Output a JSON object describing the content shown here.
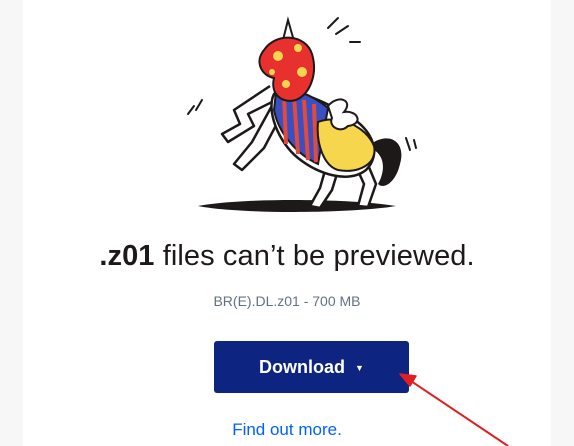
{
  "preview": {
    "extension": ".z01",
    "message_suffix": " files can’t be previewed.",
    "file_info": "BR(E).DL.z01 - 700 MB",
    "illustration_icon": "unicorn-illustration-icon"
  },
  "actions": {
    "download_label": "Download",
    "download_caret": "▼",
    "find_out_more": "Find out more."
  },
  "annotation": {
    "arrow_color": "#e02020"
  },
  "colors": {
    "button_bg": "#0d2481",
    "link": "#0061fe",
    "text_primary": "#1e1919",
    "text_secondary": "#637282"
  }
}
